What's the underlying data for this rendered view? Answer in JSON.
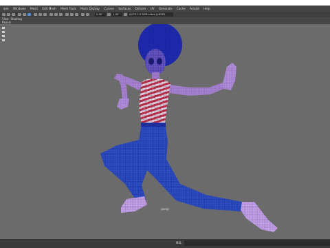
{
  "menubar": {
    "items": [
      "iple",
      "Windows",
      "Mesh",
      "Edit Mesh",
      "Mesh Tools",
      "Mesh Display",
      "Curves",
      "Surfaces",
      "Deform",
      "UV",
      "Generate",
      "Cache",
      "Arnold",
      "Help"
    ]
  },
  "toolbar": {
    "field_a": "0.00",
    "field_b": "1.00",
    "render_label": "ACES 1.0 SDR-video (sRGB)"
  },
  "panel_menu": {
    "items": [
      "View",
      "Shading"
    ],
    "second_row": "Panels"
  },
  "viewport": {
    "camera_label": "persp"
  },
  "command_line": {
    "label": "MEL"
  },
  "colors": {
    "background": "#6b6b6b",
    "wire_blue": "#2c3fb5",
    "wire_red": "#b03040",
    "skin_purple": "#a17ac9"
  }
}
